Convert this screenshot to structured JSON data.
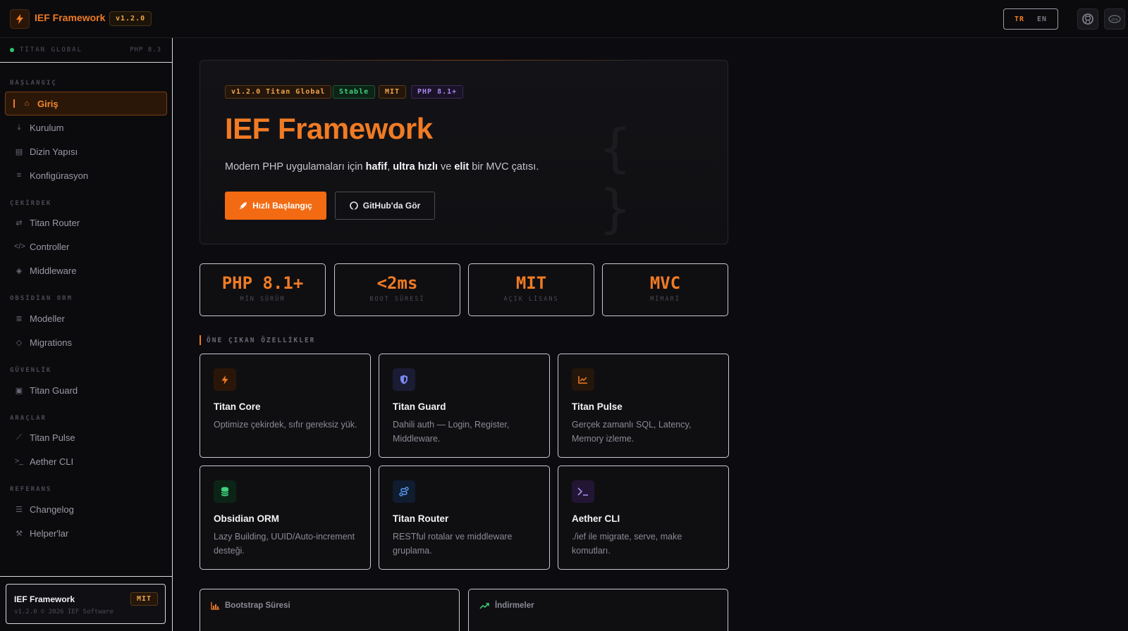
{
  "header": {
    "brand": "IEF Framework",
    "version": "v1.2.0",
    "lang_tr": "TR",
    "lang_en": "EN"
  },
  "sidebar": {
    "status_left": "TİTAN GLOBAL",
    "status_right": "PHP 8.3",
    "sections": {
      "start": "BAŞLANGIÇ",
      "core": "ÇEKİRDEK",
      "orm": "OBSİDİAN ORM",
      "security": "GÜVENLİK",
      "tools": "ARAÇLAR",
      "reference": "REFERANS"
    },
    "items": {
      "giris": "Giriş",
      "kurulum": "Kurulum",
      "dizin": "Dizin Yapısı",
      "konfig": "Konfigürasyon",
      "router": "Titan Router",
      "controller": "Controller",
      "middleware": "Middleware",
      "modeller": "Modeller",
      "migrations": "Migrations",
      "guard": "Titan Guard",
      "pulse": "Titan Pulse",
      "aether": "Aether CLI",
      "changelog": "Changelog",
      "helpers": "Helper'lar"
    },
    "footer": {
      "title": "IEF Framework",
      "subtitle": "v1.2.0 © 2026 IEF Software",
      "license": "MIT"
    }
  },
  "hero": {
    "badges": [
      "v1.2.0 Titan Global",
      "Stable",
      "MIT",
      "PHP 8.1+"
    ],
    "title": "IEF Framework",
    "lead_prefix": "Modern PHP uygulamaları için ",
    "lead_b1": "hafif",
    "lead_sep1": ", ",
    "lead_b2": "ultra hızlı",
    "lead_sep2": " ve ",
    "lead_b3": "elit",
    "lead_suffix": " bir MVC çatısı.",
    "primary_button": "Hızlı Başlangıç",
    "secondary_button": "GitHub'da Gör"
  },
  "stats": [
    {
      "value": "PHP 8.1+",
      "label": "MİN SÜRÜM"
    },
    {
      "value": "<2ms",
      "label": "BOOT SÜRESİ"
    },
    {
      "value": "MIT",
      "label": "AÇIK LİSANS"
    },
    {
      "value": "MVC",
      "label": "MİMARİ"
    }
  ],
  "features_title": "ÖNE ÇIKAN ÖZELLİKLER",
  "features": [
    {
      "title": "Titan Core",
      "desc": "Optimize çekirdek, sıfır gereksiz yük.",
      "icon": "bolt-icon",
      "color": "#f07b24"
    },
    {
      "title": "Titan Guard",
      "desc": "Dahili auth — Login, Register, Middleware.",
      "icon": "shield-icon",
      "color": "#7a86f0"
    },
    {
      "title": "Titan Pulse",
      "desc": "Gerçek zamanlı SQL, Latency, Memory izleme.",
      "icon": "chart-line-icon",
      "color": "#f07b24"
    },
    {
      "title": "Obsidian ORM",
      "desc": "Lazy Building, UUID/Auto-increment desteği.",
      "icon": "database-icon",
      "color": "#3fd07c"
    },
    {
      "title": "Titan Router",
      "desc": "RESTful rotalar ve middleware gruplama.",
      "icon": "route-icon",
      "color": "#5a9af0"
    },
    {
      "title": "Aether CLI",
      "desc": "./ief ile migrate, serve, make komutları.",
      "icon": "terminal-icon",
      "color": "#a888f0"
    }
  ],
  "bottom_cards": {
    "bootstrap": "Bootstrap Süresi",
    "downloads": "İndirmeler"
  },
  "colors": {
    "accent": "#f07b24",
    "success": "#3fd07c",
    "background": "#0c0c10"
  }
}
